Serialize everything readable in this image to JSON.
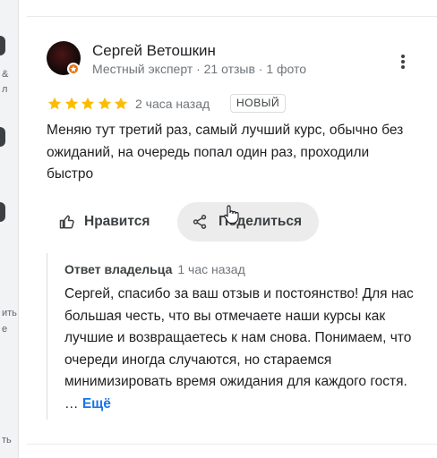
{
  "left_panel": {
    "fragments": [
      "&",
      "л",
      "ить",
      "е",
      "ть"
    ]
  },
  "review": {
    "author": {
      "name": "Сергей Ветошкин",
      "meta": "Местный эксперт · 21 отзыв · 1 фото"
    },
    "rating": 5,
    "time": "2 часа назад",
    "badge": "НОВЫЙ",
    "text": "Меняю тут третий раз, самый лучший курс, обычно без ожиданий, на очередь попал один раз, проходили быстро",
    "actions": {
      "like_label": "Нравится",
      "share_label": "Поделиться"
    },
    "owner_reply": {
      "title": "Ответ владельца",
      "time": "1 час назад",
      "text": "Сергей, спасибо за ваш отзыв и постоянство! Для нас большая честь, что вы отмечаете наши курсы как лучшие и возвращаетесь к нам снова. Понимаем, что очереди иногда случаются, но стараемся минимизировать время ожидания для каждого гостя. …",
      "more_label": "Ещё"
    }
  },
  "colors": {
    "star": "#fbbc04",
    "link": "#1a73e8",
    "badge": "#e8710a",
    "share_bg": "#ececec"
  }
}
